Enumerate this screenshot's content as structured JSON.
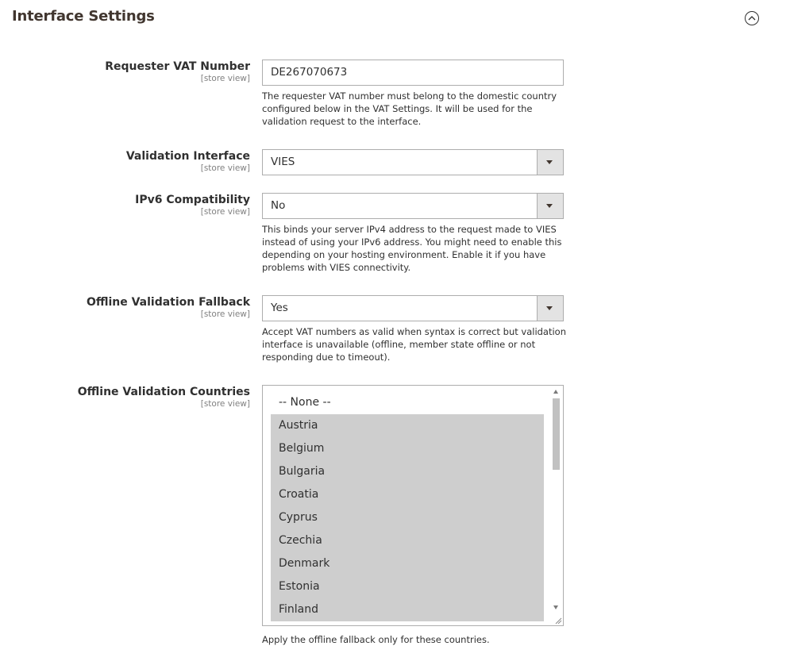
{
  "section": {
    "title": "Interface Settings",
    "collapse_icon": "chevron-up-circle-icon"
  },
  "fields": {
    "requester_vat": {
      "label": "Requester VAT Number",
      "scope": "[store view]",
      "value": "DE267070673",
      "note": "The requester VAT number must belong to the domestic country configured below in the VAT Settings. It will be used for the validation request to the interface."
    },
    "validation_interface": {
      "label": "Validation Interface",
      "scope": "[store view]",
      "value": "VIES"
    },
    "ipv6": {
      "label": "IPv6 Compatibility",
      "scope": "[store view]",
      "value": "No",
      "note": "This binds your server IPv4 address to the request made to VIES instead of using your IPv6 address. You might need to enable this depending on your hosting environment. Enable it if you have problems with VIES connectivity."
    },
    "offline_fallback": {
      "label": "Offline Validation Fallback",
      "scope": "[store view]",
      "value": "Yes",
      "note": "Accept VAT numbers as valid when syntax is correct but validation interface is unavailable (offline, member state offline or not responding due to timeout)."
    },
    "offline_countries": {
      "label": "Offline Validation Countries",
      "scope": "[store view]",
      "options": [
        {
          "label": "-- None --",
          "selected": false
        },
        {
          "label": "Austria",
          "selected": true
        },
        {
          "label": "Belgium",
          "selected": true
        },
        {
          "label": "Bulgaria",
          "selected": true
        },
        {
          "label": "Croatia",
          "selected": true
        },
        {
          "label": "Cyprus",
          "selected": true
        },
        {
          "label": "Czechia",
          "selected": true
        },
        {
          "label": "Denmark",
          "selected": true
        },
        {
          "label": "Estonia",
          "selected": true
        },
        {
          "label": "Finland",
          "selected": true
        }
      ],
      "note": "Apply the offline fallback only for these countries."
    }
  },
  "colors": {
    "selected_option_bg": "#cecece",
    "border": "#adadad",
    "select_arrow_bg": "#e3e3e3"
  }
}
